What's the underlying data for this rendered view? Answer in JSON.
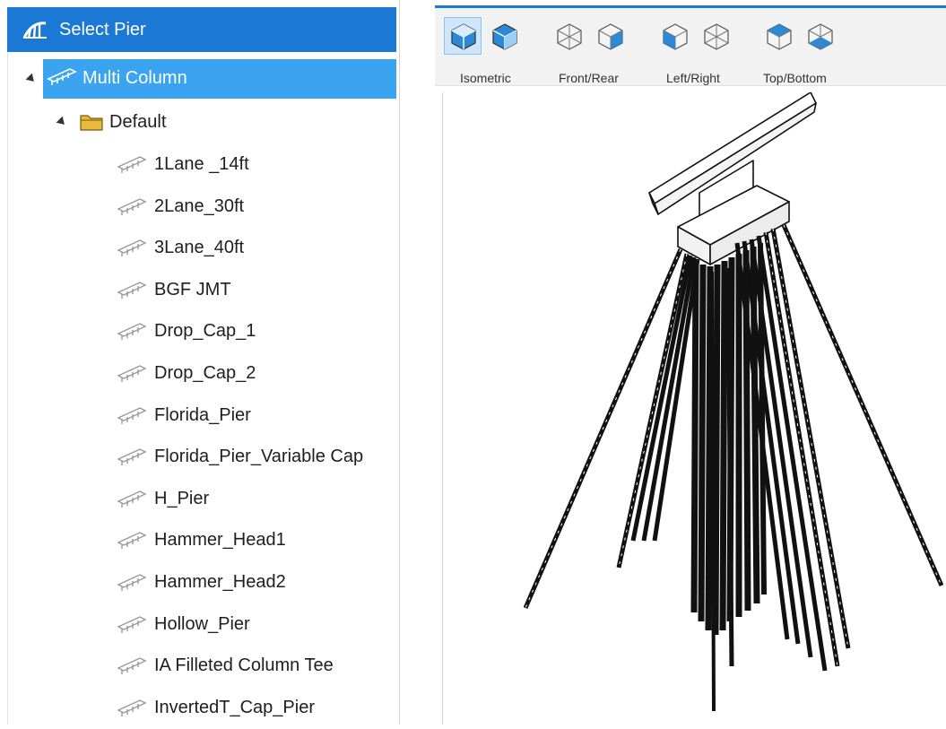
{
  "panel": {
    "title": "Select Pier"
  },
  "tree": {
    "root_label": "Multi Column",
    "folder_label": "Default",
    "items": [
      "1Lane _14ft",
      "2Lane_30ft",
      "3Lane_40ft",
      "BGF JMT",
      "Drop_Cap_1",
      "Drop_Cap_2",
      "Florida_Pier",
      "Florida_Pier_Variable Cap",
      "H_Pier",
      "Hammer_Head1",
      "Hammer_Head2",
      "Hollow_Pier",
      "IA Filleted Column Tee",
      "InvertedT_Cap_Pier"
    ]
  },
  "viewer": {
    "view_groups": [
      {
        "label": "Isometric"
      },
      {
        "label": "Front/Rear"
      },
      {
        "label": "Left/Right"
      },
      {
        "label": "Top/Bottom"
      }
    ]
  },
  "colors": {
    "title_bar": "#1b78d4",
    "selection": "#3aa4f0",
    "accent": "#1b78d4"
  }
}
